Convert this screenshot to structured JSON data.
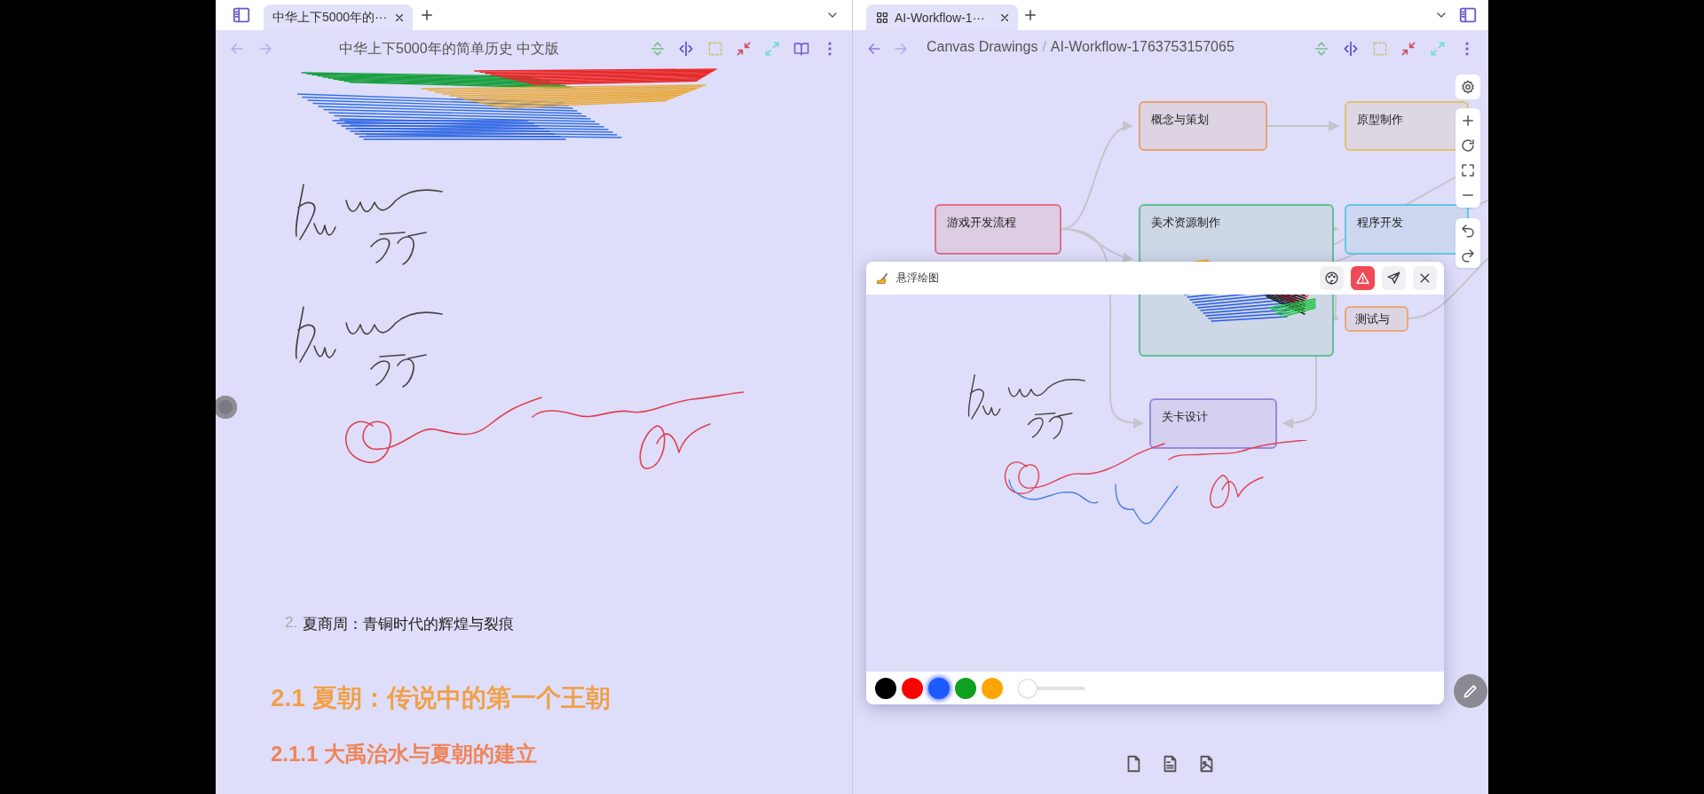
{
  "left_pane": {
    "tab": {
      "title": "中华上下5000年的···",
      "selected": true
    },
    "header_title": "中华上下5000年的简单历史 中文版",
    "document": {
      "list_items": [
        {
          "number": "2.",
          "text": "夏商周：青铜时代的辉煌与裂痕"
        }
      ],
      "heading_2": "2.1 夏朝：传说中的第一个王朝",
      "heading_3": "2.1.1 大禹治水与夏朝的建立"
    }
  },
  "right_pane": {
    "tab": {
      "title": "AI-Workflow-1···",
      "selected": true
    },
    "breadcrumb": {
      "folder": "Canvas Drawings",
      "separator": "/",
      "file": "AI-Workflow-1763753157065"
    },
    "canvas": {
      "nodes": [
        {
          "label": "概念与策划",
          "color": "#e8a070"
        },
        {
          "label": "原型制作",
          "color": "#e0c070"
        },
        {
          "label": "游戏开发流程",
          "color": "#e07088"
        },
        {
          "label": "美术资源制作",
          "color": "#60c090"
        },
        {
          "label": "程序开发",
          "color": "#60c8e0"
        },
        {
          "label": "测试与",
          "color": "#e8a878"
        },
        {
          "label": "关卡设计",
          "color": "#9a88e0"
        }
      ]
    },
    "floating_panel": {
      "title": "悬浮绘图",
      "palette": [
        {
          "color": "#000000",
          "selected": false
        },
        {
          "color": "#ff0000",
          "selected": false
        },
        {
          "color": "#1a5cff",
          "selected": true
        },
        {
          "color": "#10a020",
          "selected": false
        },
        {
          "color": "#ffa500",
          "selected": false
        }
      ],
      "brush_size": {
        "level": 0
      }
    }
  }
}
